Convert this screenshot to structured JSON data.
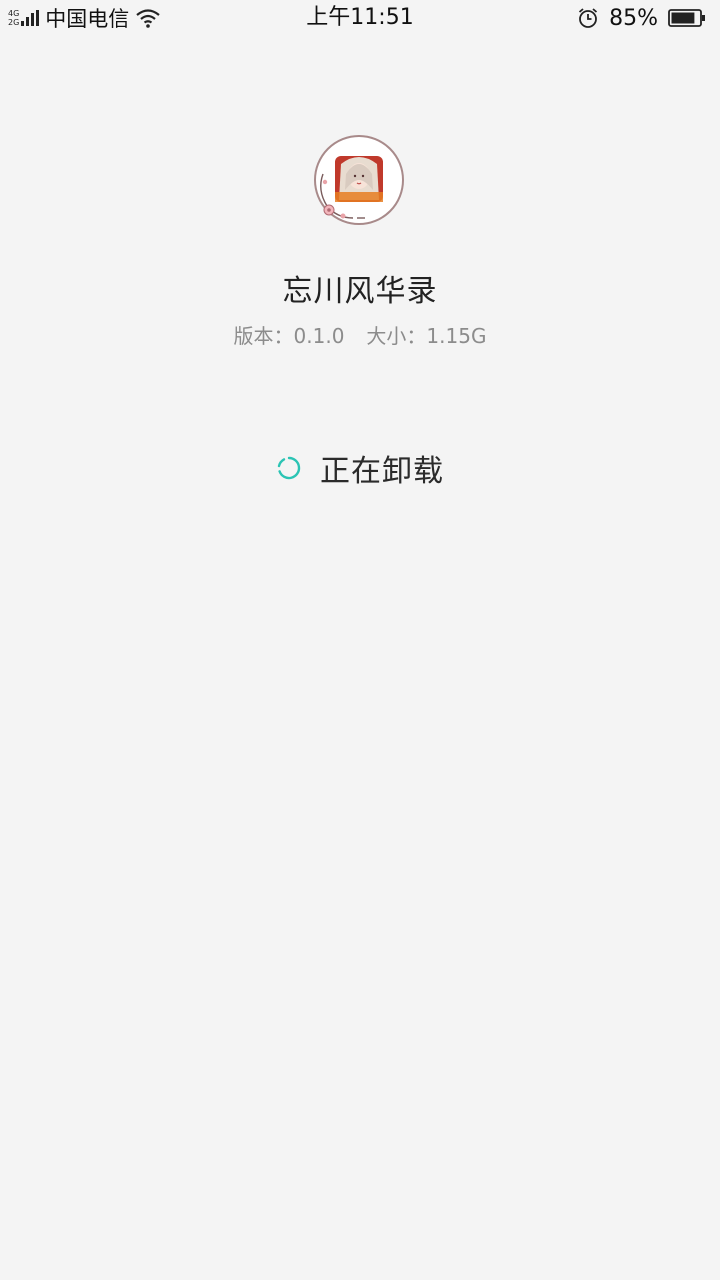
{
  "status_bar": {
    "network_top": "4G",
    "network_bottom": "2G",
    "carrier": "中国电信",
    "time": "上午11:51",
    "battery_percent": "85%",
    "battery_level": 0.85,
    "icons": [
      "signal-icon",
      "wifi-icon",
      "alarm-icon",
      "battery-icon"
    ]
  },
  "app": {
    "icon": "app-icon",
    "name": "忘川风华录",
    "version_label": "版本：",
    "version": "0.1.0",
    "size_label": "大小：",
    "size": "1.15G"
  },
  "progress": {
    "icon": "spinner-icon",
    "text": "正在卸载",
    "accent_color": "#2bc4b4"
  }
}
